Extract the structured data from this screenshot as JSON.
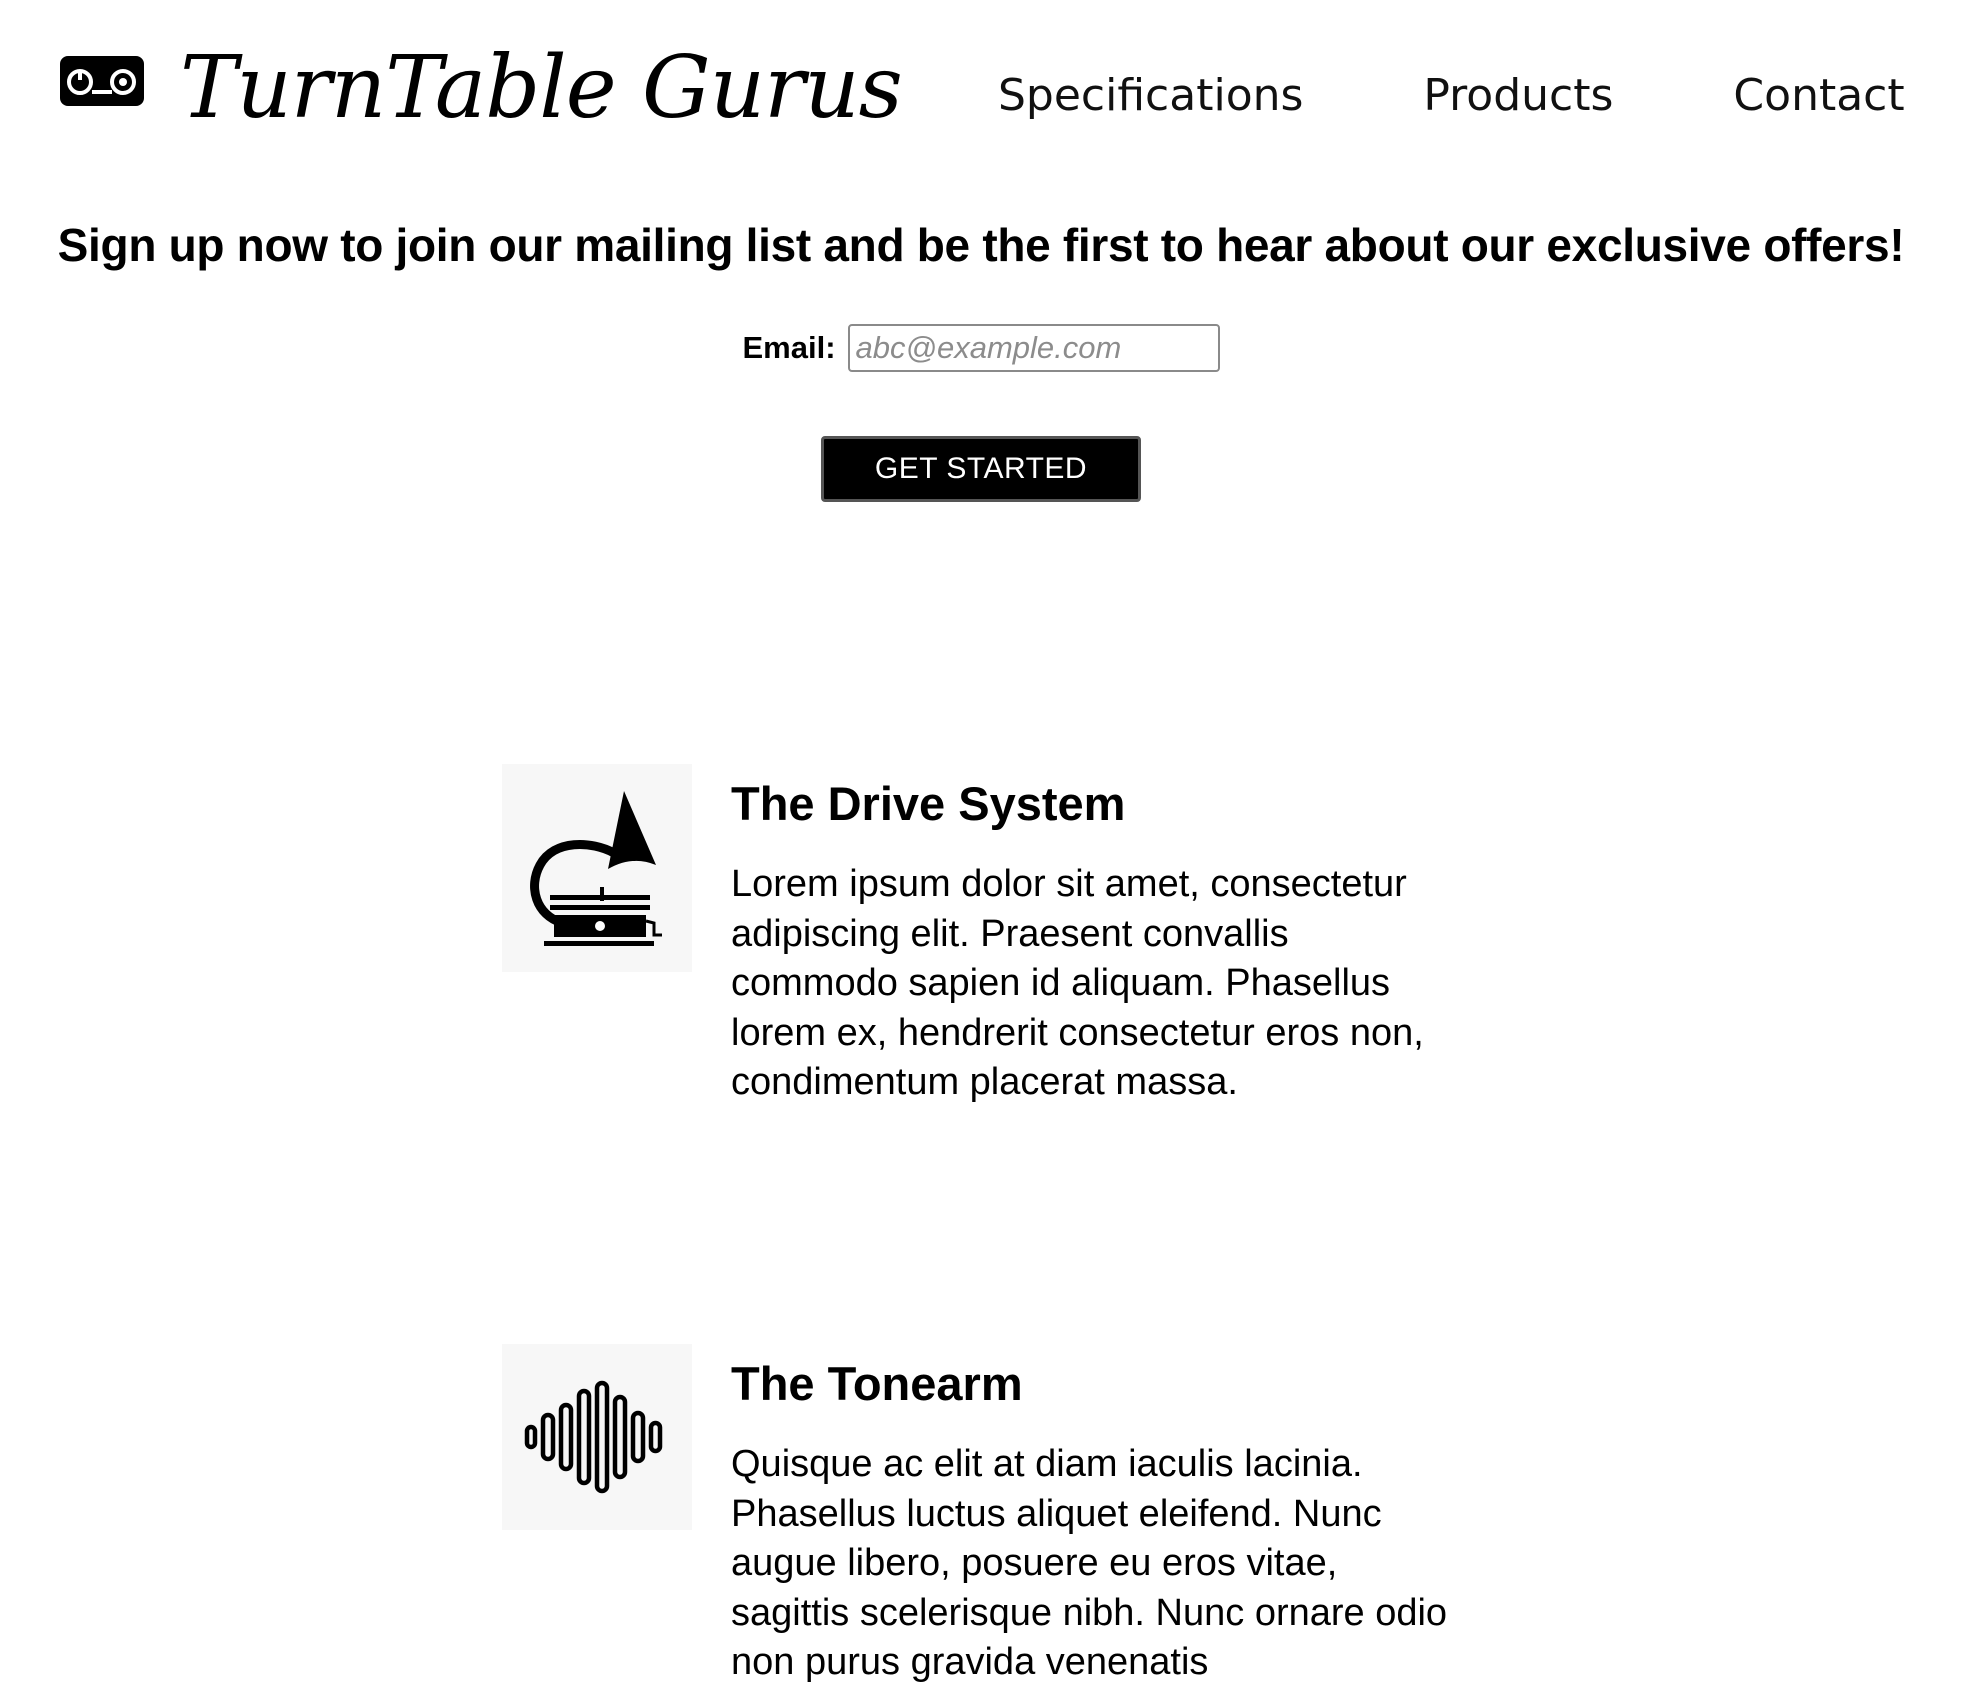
{
  "header": {
    "brand_name": "TurnTable Gurus",
    "brand_icon": "cassette-icon",
    "nav": [
      {
        "label": "Specifications"
      },
      {
        "label": "Products"
      },
      {
        "label": "Contact"
      }
    ]
  },
  "signup": {
    "title": "Sign up now to join our mailing list and be the first to hear about our exclusive offers!",
    "email_label": "Email:",
    "email_placeholder": "abc@example.com",
    "email_value": "",
    "cta_label": "GET STARTED"
  },
  "features": [
    {
      "icon": "gramophone-icon",
      "title": "The Drive System",
      "body": "Lorem ipsum dolor sit amet, consectetur adipiscing elit. Praesent convallis commodo sapien id aliquam. Phasellus lorem ex, hendrerit consectetur eros non, condimentum placerat massa."
    },
    {
      "icon": "sound-wave-icon",
      "title": "The Tonearm",
      "body": "Quisque ac elit at diam iaculis lacinia. Phasellus luctus aliquet eleifend. Nunc augue libero, posuere eu eros vitae, sagittis scelerisque nibh. Nunc ornare odio non purus gravida venenatis"
    }
  ],
  "colors": {
    "text": "#000000",
    "background": "#ffffff",
    "button_bg": "#000000",
    "button_text": "#ffffff",
    "icon_box_bg": "#f7f7f7",
    "input_border": "#8a8a8a"
  }
}
